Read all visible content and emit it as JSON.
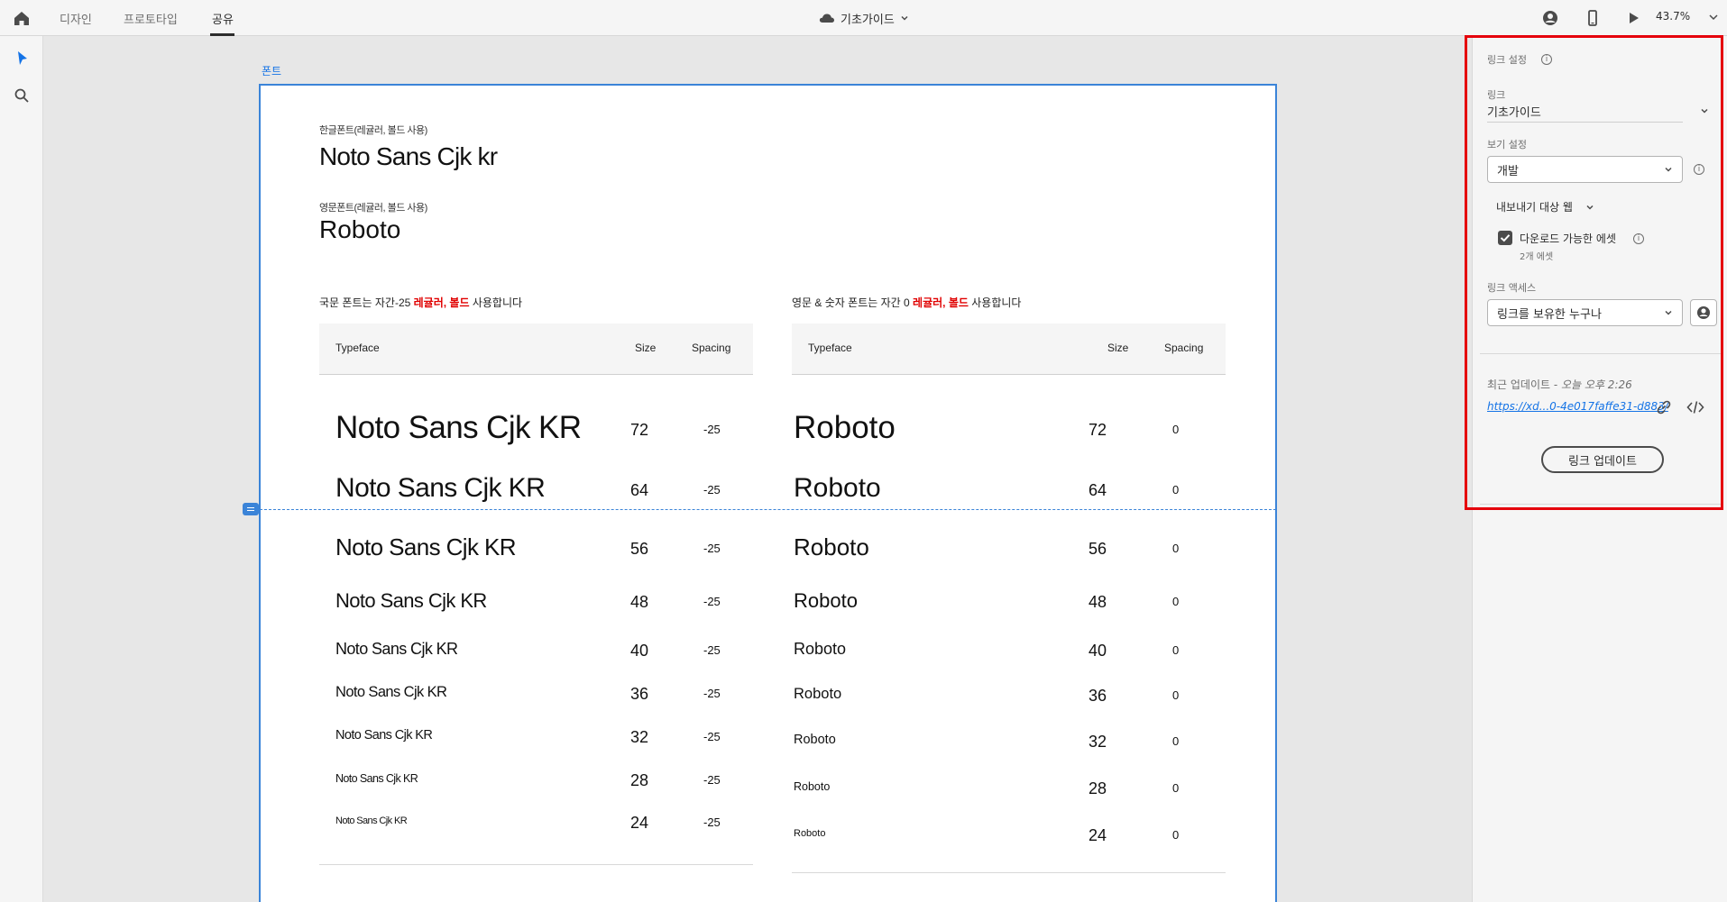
{
  "topbar": {
    "tabs": [
      "디자인",
      "프로토타입",
      "공유"
    ],
    "active_tab": "공유",
    "doc_title": "기초가이드",
    "zoom": "43.7%"
  },
  "artboard": {
    "label": "폰트",
    "kr_font_caption": "한글폰트(레귤러, 볼드 사용)",
    "kr_font_name": "Noto Sans Cjk kr",
    "en_font_caption": "영문폰트(레귤러, 볼드 사용)",
    "en_font_name": "Roboto",
    "kr_note": {
      "pre": "국문 폰트는 자간-25 ",
      "highlight": "레귤러, 볼드",
      "post": " 사용합니다"
    },
    "en_note": {
      "pre": "영문 & 숫자 폰트는 자간 0 ",
      "highlight": "레귤러, 볼드",
      "post": " 사용합니다"
    },
    "headers": {
      "typeface": "Typeface",
      "size": "Size",
      "spacing": "Spacing"
    },
    "kr_rows": [
      {
        "sample": "Noto Sans Cjk KR",
        "size": "72",
        "spacing": "-25"
      },
      {
        "sample": "Noto Sans Cjk KR",
        "size": "64",
        "spacing": "-25"
      },
      {
        "sample": "Noto Sans Cjk KR",
        "size": "56",
        "spacing": "-25"
      },
      {
        "sample": "Noto Sans Cjk KR",
        "size": "48",
        "spacing": "-25"
      },
      {
        "sample": "Noto Sans Cjk KR",
        "size": "40",
        "spacing": "-25"
      },
      {
        "sample": "Noto Sans Cjk KR",
        "size": "36",
        "spacing": "-25"
      },
      {
        "sample": "Noto Sans Cjk KR",
        "size": "32",
        "spacing": "-25"
      },
      {
        "sample": "Noto Sans Cjk KR",
        "size": "28",
        "spacing": "-25"
      },
      {
        "sample": "Noto Sans Cjk KR",
        "size": "24",
        "spacing": "-25"
      }
    ],
    "en_rows": [
      {
        "sample": "Roboto",
        "size": "72",
        "spacing": "0"
      },
      {
        "sample": "Roboto",
        "size": "64",
        "spacing": "0"
      },
      {
        "sample": "Roboto",
        "size": "56",
        "spacing": "0"
      },
      {
        "sample": "Roboto",
        "size": "48",
        "spacing": "0"
      },
      {
        "sample": "Roboto",
        "size": "40",
        "spacing": "0"
      },
      {
        "sample": "Roboto",
        "size": "36",
        "spacing": "0"
      },
      {
        "sample": "Roboto",
        "size": "32",
        "spacing": "0"
      },
      {
        "sample": "Roboto",
        "size": "28",
        "spacing": "0"
      },
      {
        "sample": "Roboto",
        "size": "24",
        "spacing": "0"
      }
    ]
  },
  "panel": {
    "section_title": "링크 설정",
    "link_label": "링크",
    "link_value": "기초가이드",
    "view_label": "보기 설정",
    "view_value": "개발",
    "export_target": "내보내기 대상 웹",
    "download_label": "다운로드 가능한 에셋",
    "download_sub": "2개 에셋",
    "access_label": "링크 액세스",
    "access_value": "링크를 보유한 누구나",
    "updated": "최근 업데이트 - ",
    "updated_time": "오늘 오후 2:26",
    "url": "https://xd...0-4e017faffe31-d883/",
    "update_button": "링크 업데이트"
  },
  "colors": {
    "accent": "#1473e6",
    "highlight_border": "#e5000b",
    "note_red": "#e00000"
  }
}
